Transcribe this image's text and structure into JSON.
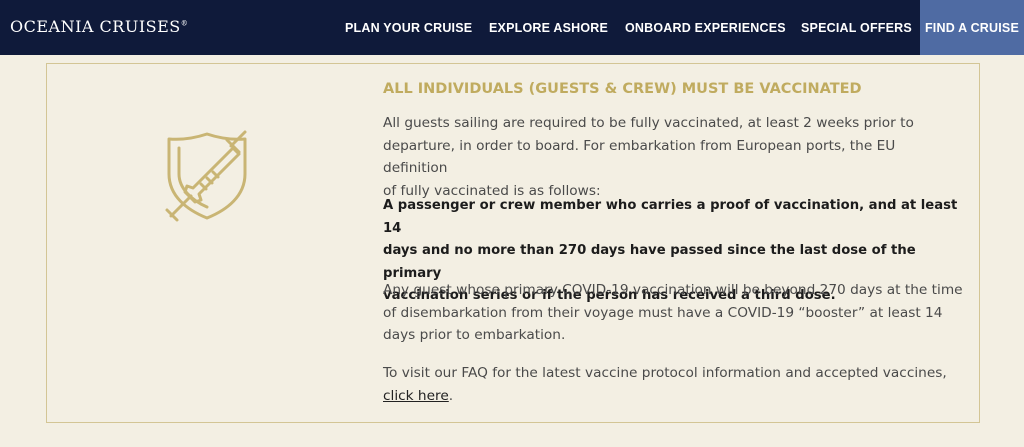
{
  "header": {
    "logo_text": "OCEANIA CRUISES",
    "logo_mark": "®",
    "nav": {
      "plan": "PLAN YOUR CRUISE",
      "explore": "EXPLORE ASHORE",
      "onboard": "ONBOARD EXPERIENCES",
      "special": "SPECIAL OFFERS",
      "find": "FIND A CRUISE"
    }
  },
  "card": {
    "icon": "shield-syringe-icon",
    "heading": "ALL INDIVIDUALS (GUESTS & CREW) MUST BE VACCINATED",
    "p1_lines": [
      "All guests sailing are required to be fully vaccinated, at least 2 weeks prior to",
      "departure, in order to board. For embarkation from European ports, the EU definition",
      "of fully vaccinated is as follows:"
    ],
    "p2_lines": [
      "A passenger or crew member who carries a proof of vaccination, and at least 14",
      "days and no more than 270 days have passed since the last dose of the primary",
      "vaccination series or if the person has received a third dose."
    ],
    "p3_lines": [
      "Any guest whose primary COVID-19 vaccination will be beyond 270 days at the time",
      "of disembarkation from their voyage must have a COVID-19 “booster” at least 14",
      "days prior to embarkation."
    ],
    "p4_line1": "To visit our FAQ for the latest vaccine protocol information and accepted vaccines,",
    "p4_link": "click here",
    "p4_end": "."
  },
  "colors": {
    "nav_bg": "#0f1a3a",
    "nav_active_bg": "#4f6ba3",
    "accent_gold": "#c0ab5f",
    "page_bg": "#f3efe3"
  }
}
